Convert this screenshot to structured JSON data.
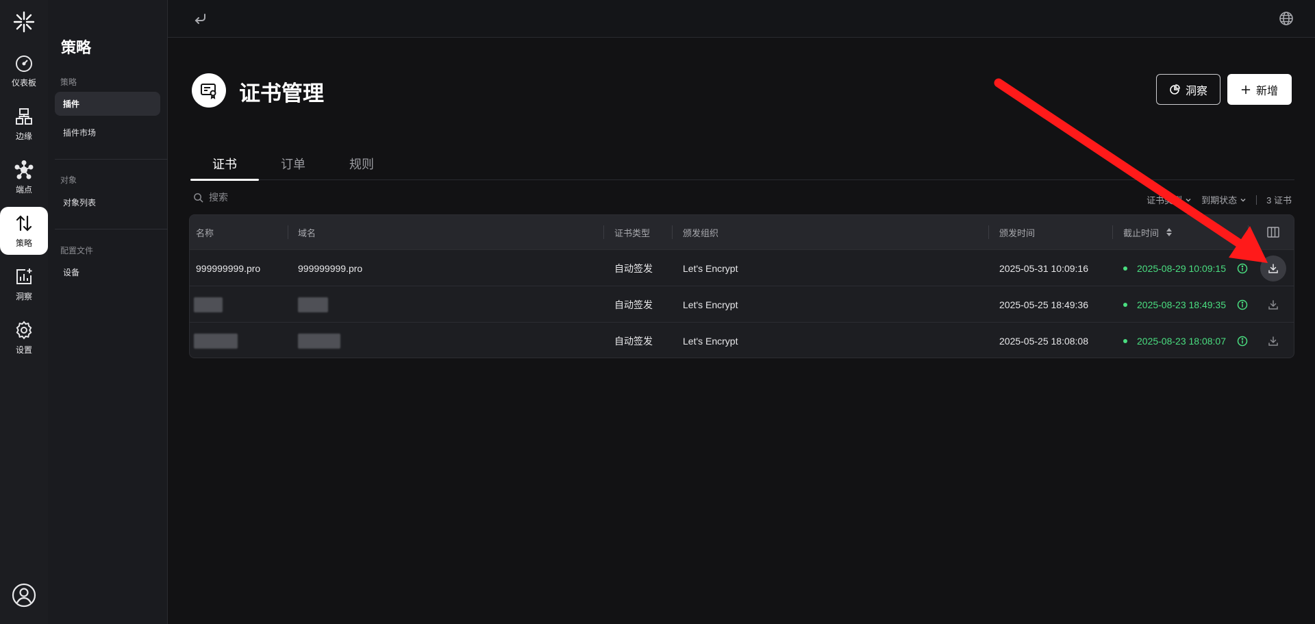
{
  "rail": {
    "items": [
      {
        "label": "仪表板",
        "icon": "dashboard-icon"
      },
      {
        "label": "边缘",
        "icon": "edge-icon"
      },
      {
        "label": "端点",
        "icon": "endpoint-icon"
      },
      {
        "label": "策略",
        "icon": "policy-icon",
        "active": true
      },
      {
        "label": "洞察",
        "icon": "insight-icon"
      },
      {
        "label": "设置",
        "icon": "settings-icon"
      }
    ]
  },
  "subnav": {
    "title": "策略",
    "groups": [
      {
        "label": "策略",
        "items": [
          {
            "label": "插件",
            "active": true
          },
          {
            "label": "插件市场"
          }
        ]
      },
      {
        "label": "对象",
        "items": [
          {
            "label": "对象列表"
          }
        ]
      },
      {
        "label": "配置文件",
        "items": [
          {
            "label": "设备"
          }
        ]
      }
    ]
  },
  "page": {
    "title": "证书管理",
    "insight_button": "洞察",
    "add_button": "新增"
  },
  "tabs": [
    {
      "label": "证书",
      "active": true
    },
    {
      "label": "订单"
    },
    {
      "label": "规则"
    }
  ],
  "toolbar": {
    "search_placeholder": "搜索",
    "filter_type": "证书类型",
    "filter_status": "到期状态",
    "count": "3 证书"
  },
  "table": {
    "columns": [
      "名称",
      "域名",
      "证书类型",
      "颁发组织",
      "颁发时间",
      "截止时间"
    ],
    "rows": [
      {
        "name": "999999999.pro",
        "domain": "999999999.pro",
        "type": "自动签发",
        "issuer": "Let's Encrypt",
        "issued": "2025-05-31 10:09:16",
        "expires": "2025-08-29 10:09:15"
      },
      {
        "name": "",
        "domain": "",
        "type": "自动签发",
        "issuer": "Let's Encrypt",
        "issued": "2025-05-25 18:49:36",
        "expires": "2025-08-23 18:49:35"
      },
      {
        "name": "",
        "domain": "",
        "type": "自动签发",
        "issuer": "Let's Encrypt",
        "issued": "2025-05-25 18:08:08",
        "expires": "2025-08-23 18:08:07"
      }
    ]
  },
  "colors": {
    "expiry_ok": "#4ade80",
    "annotation_arrow": "#ff1a1a"
  }
}
